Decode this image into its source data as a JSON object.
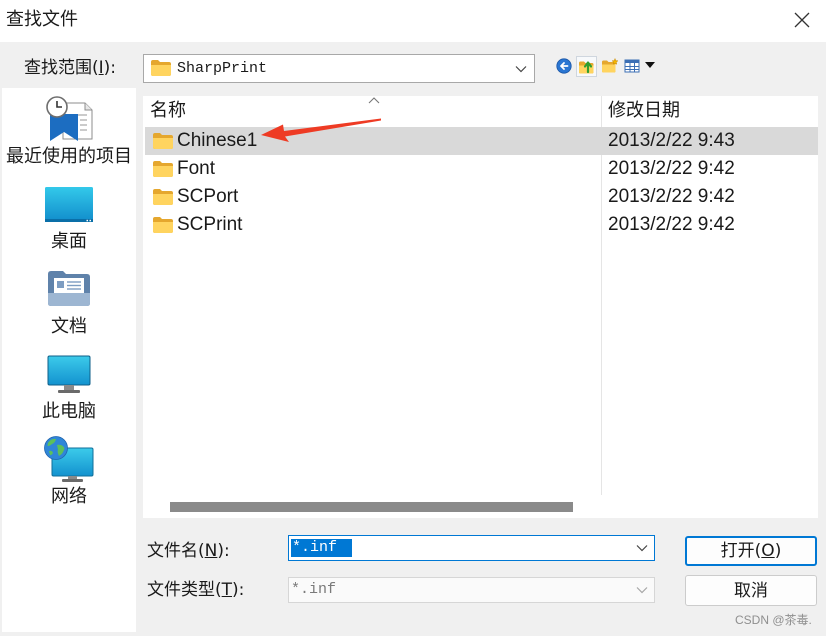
{
  "window": {
    "title": "查找文件",
    "close_icon": "close-icon"
  },
  "look_in": {
    "label_before": "查找范围(",
    "accel": "I",
    "label_after": "):",
    "value": "SharpPrint",
    "icon": "folder-icon"
  },
  "toolbar": {
    "back_icon": "back-icon",
    "up_icon": "up-one-level-icon",
    "new_folder_icon": "new-folder-icon",
    "view_icon": "view-menu-icon"
  },
  "places": [
    {
      "label": "最近使用的项目",
      "icon": "recent-items-icon"
    },
    {
      "label": "桌面",
      "icon": "desktop-icon"
    },
    {
      "label": "文档",
      "icon": "documents-icon"
    },
    {
      "label": "此电脑",
      "icon": "this-pc-icon"
    },
    {
      "label": "网络",
      "icon": "network-icon"
    }
  ],
  "file_list": {
    "columns": [
      {
        "label": "名称"
      },
      {
        "label": "修改日期"
      }
    ],
    "sort_icon": "sort-ascending-icon",
    "rows": [
      {
        "name": "Chinese1",
        "modified": "2013/2/22 9:43",
        "icon": "folder-icon",
        "selected": true
      },
      {
        "name": "Font",
        "modified": "2013/2/22 9:42",
        "icon": "folder-icon",
        "selected": false
      },
      {
        "name": "SCPort",
        "modified": "2013/2/22 9:42",
        "icon": "folder-icon",
        "selected": false
      },
      {
        "name": "SCPrint",
        "modified": "2013/2/22 9:42",
        "icon": "folder-icon",
        "selected": false
      }
    ]
  },
  "file_name": {
    "label_before": "文件名(",
    "accel": "N",
    "label_after": "):",
    "value": "*.inf",
    "value_selected": true
  },
  "file_type": {
    "label_before": "文件类型(",
    "accel": "T",
    "label_after": "):",
    "value": "*.inf",
    "enabled": false
  },
  "buttons": {
    "open": {
      "label_before": "打开(",
      "accel": "O",
      "label_after": ")"
    },
    "cancel": {
      "label": "取消"
    }
  },
  "watermark": "CSDN @茶毒.",
  "colors": {
    "accent": "#0078d4",
    "selection": "#d9d9d9",
    "annotation": "#ee3b24",
    "scrollbar_thumb": "#8a8a8a"
  }
}
